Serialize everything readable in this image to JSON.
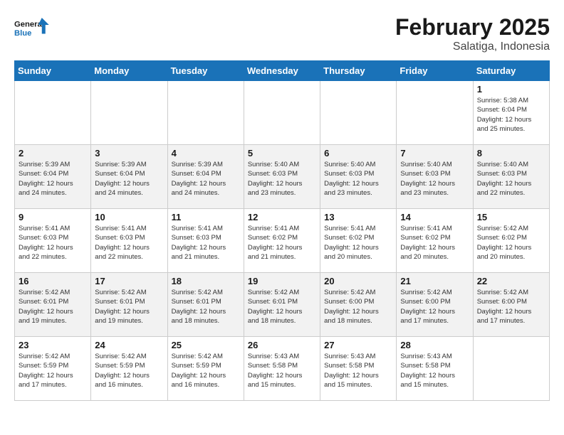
{
  "header": {
    "logo_line1": "General",
    "logo_line2": "Blue",
    "title": "February 2025",
    "subtitle": "Salatiga, Indonesia"
  },
  "weekdays": [
    "Sunday",
    "Monday",
    "Tuesday",
    "Wednesday",
    "Thursday",
    "Friday",
    "Saturday"
  ],
  "weeks": [
    [
      {
        "day": "",
        "info": ""
      },
      {
        "day": "",
        "info": ""
      },
      {
        "day": "",
        "info": ""
      },
      {
        "day": "",
        "info": ""
      },
      {
        "day": "",
        "info": ""
      },
      {
        "day": "",
        "info": ""
      },
      {
        "day": "1",
        "info": "Sunrise: 5:38 AM\nSunset: 6:04 PM\nDaylight: 12 hours\nand 25 minutes."
      }
    ],
    [
      {
        "day": "2",
        "info": "Sunrise: 5:39 AM\nSunset: 6:04 PM\nDaylight: 12 hours\nand 24 minutes."
      },
      {
        "day": "3",
        "info": "Sunrise: 5:39 AM\nSunset: 6:04 PM\nDaylight: 12 hours\nand 24 minutes."
      },
      {
        "day": "4",
        "info": "Sunrise: 5:39 AM\nSunset: 6:04 PM\nDaylight: 12 hours\nand 24 minutes."
      },
      {
        "day": "5",
        "info": "Sunrise: 5:40 AM\nSunset: 6:03 PM\nDaylight: 12 hours\nand 23 minutes."
      },
      {
        "day": "6",
        "info": "Sunrise: 5:40 AM\nSunset: 6:03 PM\nDaylight: 12 hours\nand 23 minutes."
      },
      {
        "day": "7",
        "info": "Sunrise: 5:40 AM\nSunset: 6:03 PM\nDaylight: 12 hours\nand 23 minutes."
      },
      {
        "day": "8",
        "info": "Sunrise: 5:40 AM\nSunset: 6:03 PM\nDaylight: 12 hours\nand 22 minutes."
      }
    ],
    [
      {
        "day": "9",
        "info": "Sunrise: 5:41 AM\nSunset: 6:03 PM\nDaylight: 12 hours\nand 22 minutes."
      },
      {
        "day": "10",
        "info": "Sunrise: 5:41 AM\nSunset: 6:03 PM\nDaylight: 12 hours\nand 22 minutes."
      },
      {
        "day": "11",
        "info": "Sunrise: 5:41 AM\nSunset: 6:03 PM\nDaylight: 12 hours\nand 21 minutes."
      },
      {
        "day": "12",
        "info": "Sunrise: 5:41 AM\nSunset: 6:02 PM\nDaylight: 12 hours\nand 21 minutes."
      },
      {
        "day": "13",
        "info": "Sunrise: 5:41 AM\nSunset: 6:02 PM\nDaylight: 12 hours\nand 20 minutes."
      },
      {
        "day": "14",
        "info": "Sunrise: 5:41 AM\nSunset: 6:02 PM\nDaylight: 12 hours\nand 20 minutes."
      },
      {
        "day": "15",
        "info": "Sunrise: 5:42 AM\nSunset: 6:02 PM\nDaylight: 12 hours\nand 20 minutes."
      }
    ],
    [
      {
        "day": "16",
        "info": "Sunrise: 5:42 AM\nSunset: 6:01 PM\nDaylight: 12 hours\nand 19 minutes."
      },
      {
        "day": "17",
        "info": "Sunrise: 5:42 AM\nSunset: 6:01 PM\nDaylight: 12 hours\nand 19 minutes."
      },
      {
        "day": "18",
        "info": "Sunrise: 5:42 AM\nSunset: 6:01 PM\nDaylight: 12 hours\nand 18 minutes."
      },
      {
        "day": "19",
        "info": "Sunrise: 5:42 AM\nSunset: 6:01 PM\nDaylight: 12 hours\nand 18 minutes."
      },
      {
        "day": "20",
        "info": "Sunrise: 5:42 AM\nSunset: 6:00 PM\nDaylight: 12 hours\nand 18 minutes."
      },
      {
        "day": "21",
        "info": "Sunrise: 5:42 AM\nSunset: 6:00 PM\nDaylight: 12 hours\nand 17 minutes."
      },
      {
        "day": "22",
        "info": "Sunrise: 5:42 AM\nSunset: 6:00 PM\nDaylight: 12 hours\nand 17 minutes."
      }
    ],
    [
      {
        "day": "23",
        "info": "Sunrise: 5:42 AM\nSunset: 5:59 PM\nDaylight: 12 hours\nand 17 minutes."
      },
      {
        "day": "24",
        "info": "Sunrise: 5:42 AM\nSunset: 5:59 PM\nDaylight: 12 hours\nand 16 minutes."
      },
      {
        "day": "25",
        "info": "Sunrise: 5:42 AM\nSunset: 5:59 PM\nDaylight: 12 hours\nand 16 minutes."
      },
      {
        "day": "26",
        "info": "Sunrise: 5:43 AM\nSunset: 5:58 PM\nDaylight: 12 hours\nand 15 minutes."
      },
      {
        "day": "27",
        "info": "Sunrise: 5:43 AM\nSunset: 5:58 PM\nDaylight: 12 hours\nand 15 minutes."
      },
      {
        "day": "28",
        "info": "Sunrise: 5:43 AM\nSunset: 5:58 PM\nDaylight: 12 hours\nand 15 minutes."
      },
      {
        "day": "",
        "info": ""
      }
    ]
  ]
}
